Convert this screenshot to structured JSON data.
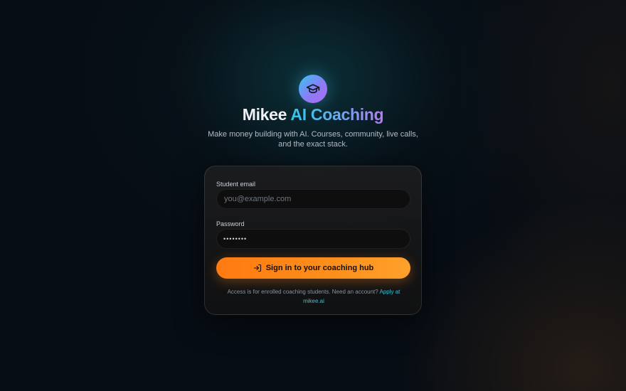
{
  "brand": {
    "icon": "graduation-cap-icon",
    "title_part1": "Mikee",
    "title_part2": "AI Coaching",
    "subtitle": "Make money building with AI. Courses, community, live calls, and the exact stack."
  },
  "login_form": {
    "email_label": "Student email",
    "email_placeholder": "you@example.com",
    "email_value": "",
    "password_label": "Password",
    "password_value": "••••••••",
    "submit_icon": "sign-in-icon",
    "submit_label": "Sign in to your coaching hub",
    "note_text": "Access is for enrolled coaching students. Need an account?",
    "note_link": "Apply at mikee.ai"
  },
  "colors": {
    "background": "#070d14",
    "accent_orange": "#ff7a12",
    "accent_cyan": "#2ec5e2",
    "accent_purple": "#b06cf2"
  }
}
